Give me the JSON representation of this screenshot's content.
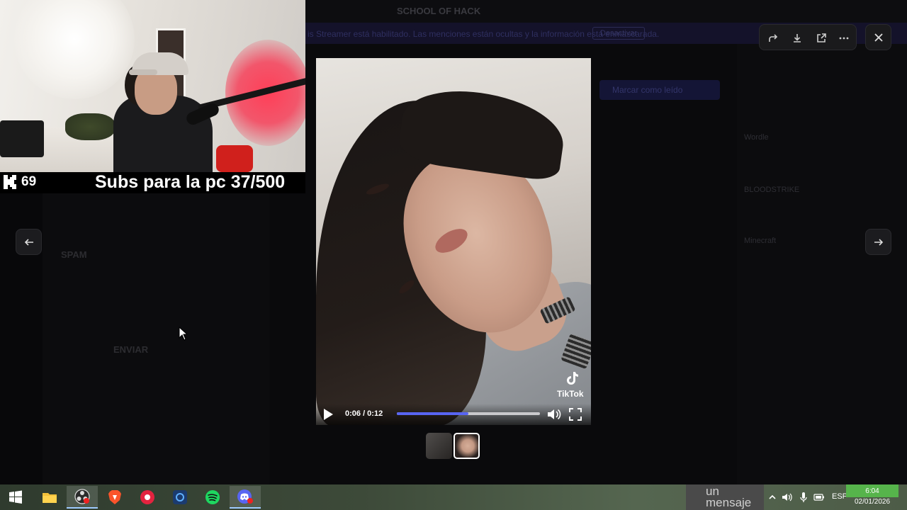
{
  "background_app": {
    "window_title": "SCHOOL OF HACK",
    "banner_text": "is Streamer está habilitado. Las menciones están ocultas y la información está enmascarada.",
    "banner_button": "Desactivar",
    "unread_label": "Marcar como leído",
    "channels": [
      "SPAM",
      "ENVIAR"
    ],
    "right_panel_items": [
      "Wordle",
      "BLOODSTRIKE",
      "Minecraft"
    ],
    "message_input_fragment": "un mensaje"
  },
  "stream_overlay": {
    "viewer_count": "69",
    "subs_text": "Subs para la pc 37/500"
  },
  "media_viewer": {
    "toolbar_icons": [
      "forward-icon",
      "download-icon",
      "open-external-icon",
      "more-icon"
    ],
    "watermark_label": "TikTok",
    "time_display": "0:06 / 0:12",
    "progress_fraction": 0.5,
    "accent_color": "#5865f2",
    "thumbnails_count": 2
  },
  "taskbar": {
    "apps": [
      "windows-start-icon",
      "file-explorer-icon",
      "obs-icon",
      "brave-icon",
      "app-red-icon",
      "app-blue-icon",
      "spotify-icon",
      "discord-icon"
    ],
    "language": "ESP",
    "time": "6:04",
    "date": "02/01/2026"
  }
}
